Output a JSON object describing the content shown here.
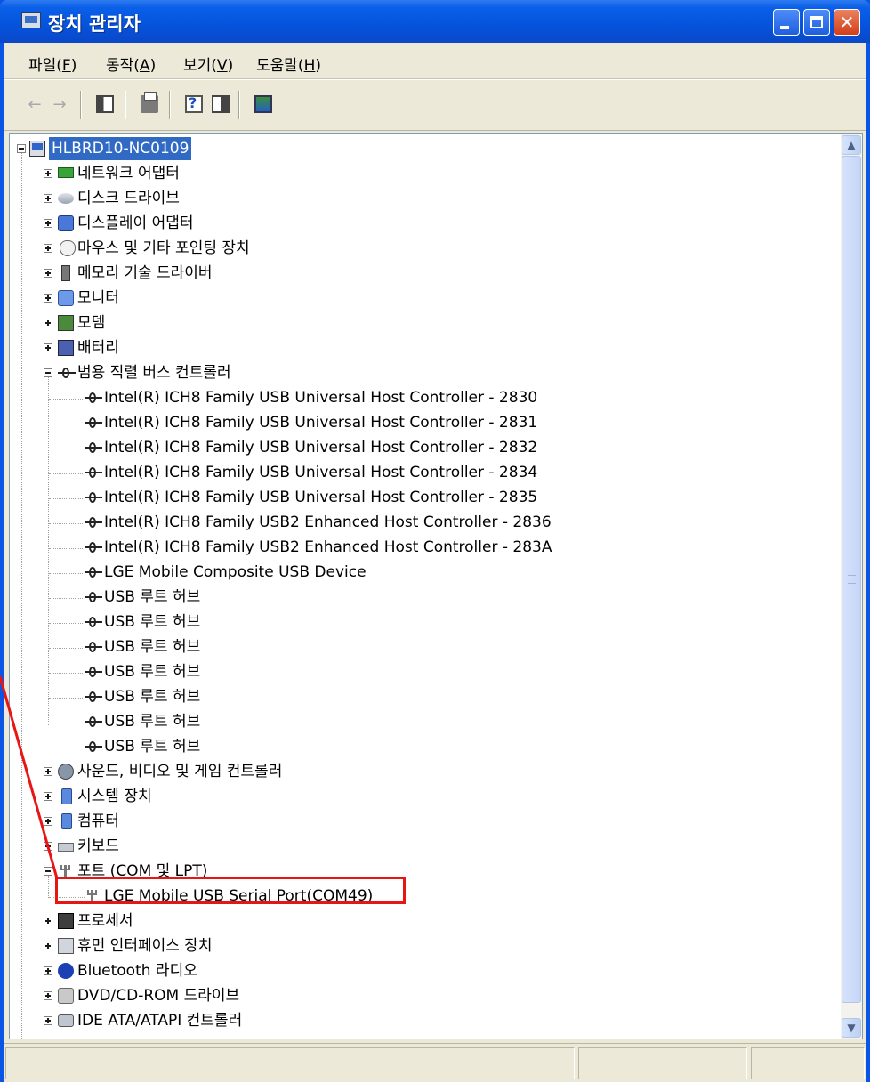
{
  "window": {
    "title": "장치 관리자"
  },
  "menu": [
    {
      "text": "파일(",
      "acc": "F",
      "end": ")"
    },
    {
      "text": "동작(",
      "acc": "A",
      "end": ")"
    },
    {
      "text": "보기(",
      "acc": "V",
      "end": ")"
    },
    {
      "text": "도움말(",
      "acc": "H",
      "end": ")"
    }
  ],
  "toolbar": {
    "back_icon": "back-arrow-icon",
    "forward_icon": "forward-arrow-icon",
    "tools": [
      "show-hide-console-tree-icon",
      "print-icon",
      "help-icon",
      "properties-icon",
      "scan-hardware-icon"
    ]
  },
  "tree": {
    "root": "HLBRD10-NC0109",
    "categories": {
      "network": "네트워크 어댑터",
      "disk": "디스크 드라이브",
      "display": "디스플레이 어댑터",
      "mouse": "마우스 및 기타 포인팅 장치",
      "memory": "메모리 기술 드라이버",
      "monitor": "모니터",
      "modem": "모뎀",
      "battery": "배터리",
      "usb": "범용 직렬 버스 컨트롤러",
      "sound": "사운드, 비디오 및 게임 컨트롤러",
      "system": "시스템 장치",
      "computer": "컴퓨터",
      "keyboard": "키보드",
      "ports": "포트 (COM 및 LPT)",
      "processor": "프로세서",
      "hid": "휴먼 인터페이스 장치",
      "bluetooth": "Bluetooth 라디오",
      "dvd": "DVD/CD-ROM 드라이브",
      "ide": "IDE ATA/ATAPI 컨트롤러"
    },
    "usb_devices": [
      "Intel(R) ICH8 Family USB Universal Host Controller - 2830",
      "Intel(R) ICH8 Family USB Universal Host Controller - 2831",
      "Intel(R) ICH8 Family USB Universal Host Controller - 2832",
      "Intel(R) ICH8 Family USB Universal Host Controller - 2834",
      "Intel(R) ICH8 Family USB Universal Host Controller - 2835",
      "Intel(R) ICH8 Family USB2 Enhanced Host Controller - 2836",
      "Intel(R) ICH8 Family USB2 Enhanced Host Controller - 283A",
      "LGE Mobile Composite USB Device",
      "USB 루트 허브",
      "USB 루트 허브",
      "USB 루트 허브",
      "USB 루트 허브",
      "USB 루트 허브",
      "USB 루트 허브",
      "USB 루트 허브"
    ],
    "port_devices": [
      "LGE Mobile USB Serial Port(COM49)"
    ]
  },
  "annotation": {
    "color": "#e81515"
  },
  "colors": {
    "selection": "#316ac5",
    "titlebar": "#0553dc"
  }
}
